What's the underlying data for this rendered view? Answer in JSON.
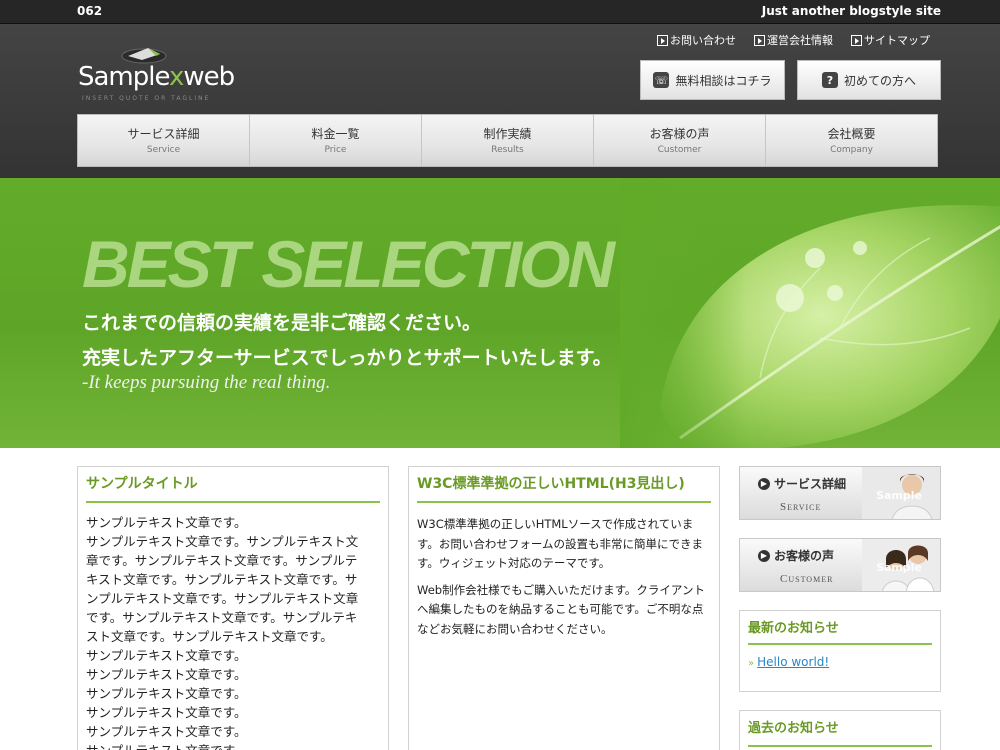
{
  "topbar": {
    "site_no": "062",
    "tagline": "Just another blogstyle site"
  },
  "logo": {
    "pre": "Sample",
    "x": "x",
    "post": "web",
    "sub": "INSERT QUOTE OR TAGLINE"
  },
  "toplinks": [
    {
      "label": "お問い合わせ"
    },
    {
      "label": "運営会社情報"
    },
    {
      "label": "サイトマップ"
    }
  ],
  "header_buttons": {
    "consult": {
      "label": "無料相談はコチラ",
      "icon": "phone-icon"
    },
    "first": {
      "label": "初めての方へ",
      "icon": "question-icon"
    }
  },
  "nav": [
    {
      "ja": "サービス詳細",
      "en": "Service"
    },
    {
      "ja": "料金一覧",
      "en": "Price"
    },
    {
      "ja": "制作実績",
      "en": "Results"
    },
    {
      "ja": "お客様の声",
      "en": "Customer"
    },
    {
      "ja": "会社概要",
      "en": "Company"
    }
  ],
  "hero": {
    "headline": "BEST SELECTION",
    "line1": "これまでの信頼の実績を是非ご確認ください。",
    "line2": "充実したアフターサービスでしっかりとサポートいたします。",
    "line3": "-It keeps pursuing the real thing."
  },
  "col1": {
    "title": "サンプルタイトル",
    "paragraphs": [
      "サンプルテキスト文章です。",
      "サンプルテキスト文章です。サンプルテキスト文",
      "章です。サンプルテキスト文章です。サンプルテ",
      "キスト文章です。サンプルテキスト文章です。サ",
      "ンプルテキスト文章です。サンプルテキスト文章",
      "です。サンプルテキスト文章です。サンプルテキ",
      "スト文章です。サンプルテキスト文章です。",
      "サンプルテキスト文章です。",
      "サンプルテキスト文章です。",
      "サンプルテキスト文章です。",
      "サンプルテキスト文章です。",
      "サンプルテキスト文章です。",
      "サンプルテキスト文章です。"
    ]
  },
  "col2": {
    "title": "W3C標準準拠の正しいHTML(H3見出し)",
    "p1": "W3C標準準拠の正しいHTMLソースで作成されています。お問い合わせフォームの設置も非常に簡単にできます。ウィジェット対応のテーマです。",
    "p2": "Web制作会社様でもご購入いただけます。クライアントへ編集したものを納品することも可能です。ご不明な点などお気軽にお問い合わせください。"
  },
  "sidebar": {
    "service_banner": {
      "title": "サービス詳細",
      "en": "Service",
      "sample": "Sample"
    },
    "customer_banner": {
      "title": "お客様の声",
      "en": "Customer",
      "sample": "Sample"
    },
    "news": {
      "title": "最新のお知らせ",
      "item": "Hello world!"
    },
    "past": {
      "title": "過去のお知らせ"
    }
  },
  "colors": {
    "accent": "#8bc34a",
    "heading": "#6a9a26",
    "link": "#2a86c9",
    "header_bg": "#3a3a3a",
    "hero_green": "#5ea527"
  }
}
